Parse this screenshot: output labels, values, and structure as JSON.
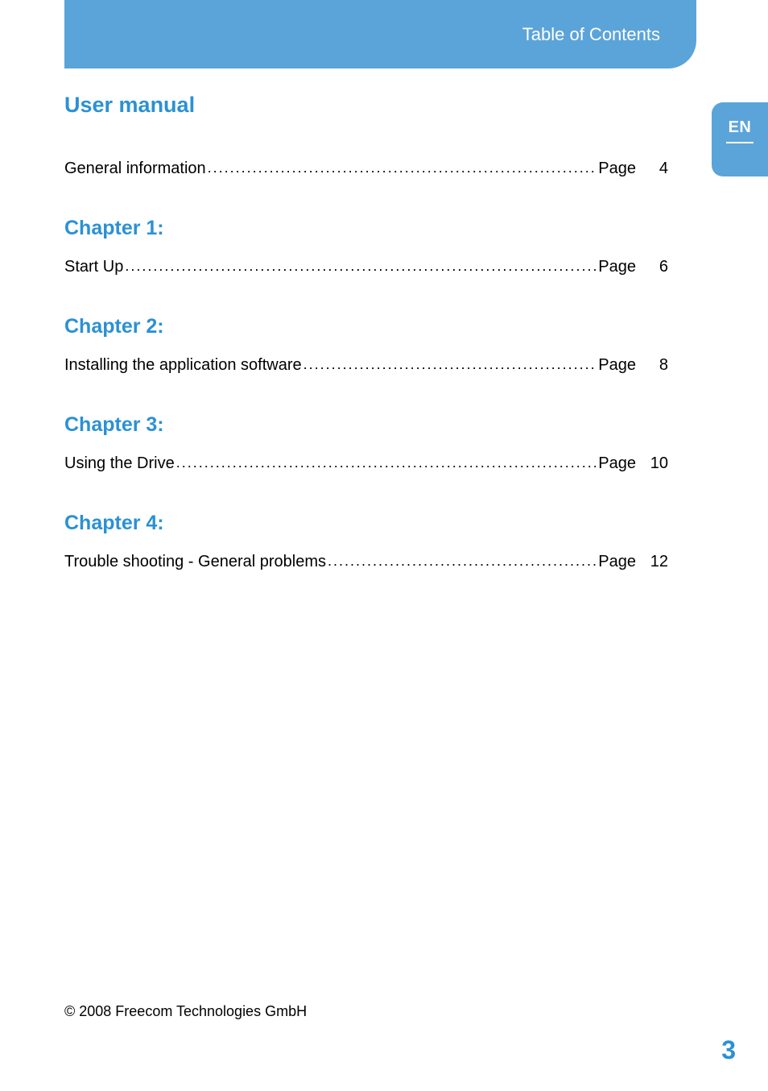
{
  "header": {
    "title": "Table of Contents"
  },
  "langTab": {
    "label": "EN"
  },
  "mainTitle": "User manual",
  "sections": [
    {
      "chapter": null,
      "items": [
        {
          "label": "General information",
          "pageWord": "Page",
          "pageNum": "4"
        }
      ]
    },
    {
      "chapter": "Chapter 1:",
      "items": [
        {
          "label": "Start Up",
          "pageWord": "Page",
          "pageNum": "6"
        }
      ]
    },
    {
      "chapter": "Chapter 2:",
      "items": [
        {
          "label": "Installing the application software",
          "pageWord": "Page",
          "pageNum": "8"
        }
      ]
    },
    {
      "chapter": "Chapter 3:",
      "items": [
        {
          "label": "Using the Drive",
          "pageWord": "Page",
          "pageNum": "10"
        }
      ]
    },
    {
      "chapter": "Chapter 4:",
      "items": [
        {
          "label": "Trouble shooting - General problems",
          "pageWord": "Page",
          "pageNum": "12"
        }
      ]
    }
  ],
  "footer": {
    "copyright": "© 2008 Freecom Technologies GmbH"
  },
  "pageNumber": "3"
}
